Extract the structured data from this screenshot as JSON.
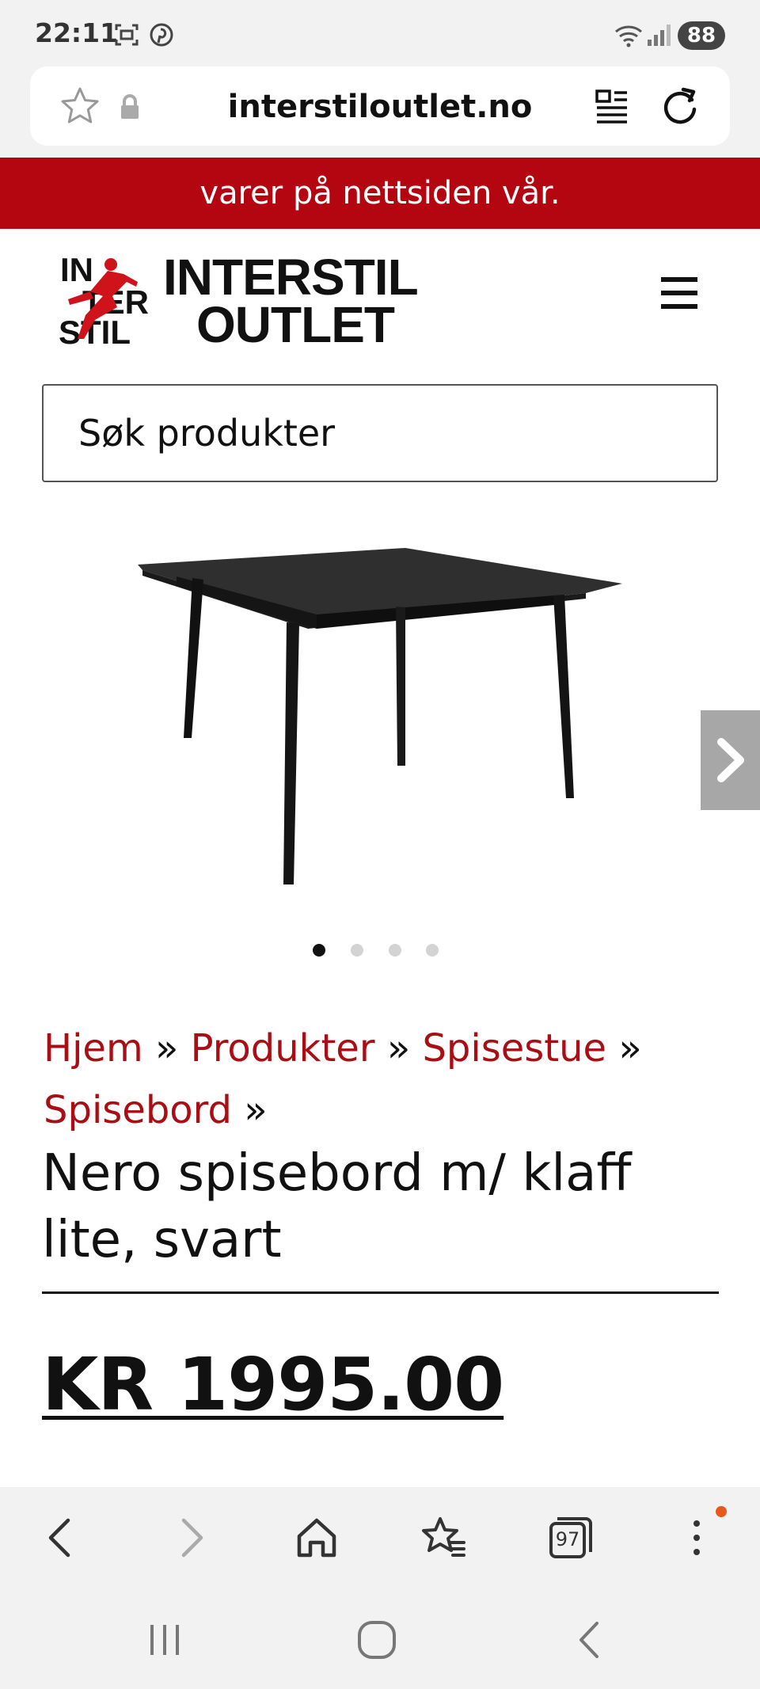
{
  "status_bar": {
    "time": "22:11",
    "battery": "88"
  },
  "browser": {
    "url": "interstiloutlet.no"
  },
  "banner": {
    "text": "varer på nettsiden vår."
  },
  "logo": {
    "brand_top": "INTERSTIL",
    "brand_bottom": "OUTLET",
    "mark": [
      "IN",
      "TER",
      "STIL"
    ]
  },
  "search": {
    "placeholder": "Søk produkter"
  },
  "gallery": {
    "slides": 4,
    "active": 1
  },
  "breadcrumb": {
    "items": [
      "Hjem",
      "Produkter",
      "Spisestue",
      "Spisebord"
    ],
    "separator": "»"
  },
  "product": {
    "title": "Nero spisebord m/ klaff lite, svart",
    "price": "KR 1995.00"
  },
  "toolbar": {
    "tabs_count": "97"
  },
  "colors": {
    "brand_red": "#b30610",
    "link_red": "#a80e14",
    "notification": "#e8571c"
  }
}
